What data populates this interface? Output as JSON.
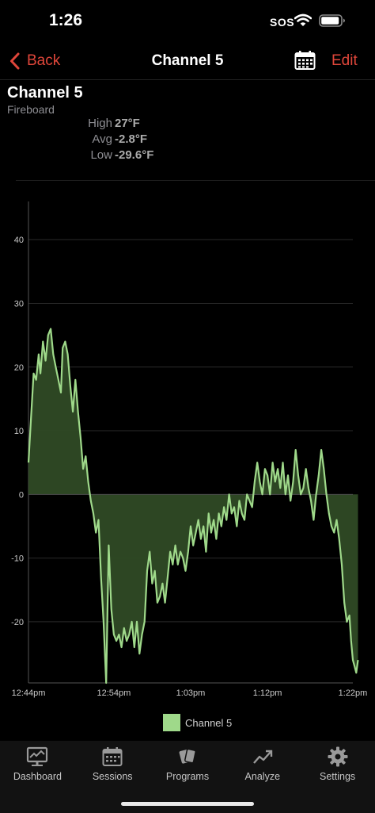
{
  "status_bar": {
    "time": "1:26",
    "carrier": "SOS"
  },
  "nav": {
    "back_label": "Back",
    "title": "Channel 5",
    "edit_label": "Edit"
  },
  "header": {
    "title": "Channel 5",
    "subtitle": "Fireboard",
    "stats": [
      {
        "label": "High",
        "value": "27°F"
      },
      {
        "label": "Avg",
        "value": "-2.8°F"
      },
      {
        "label": "Low",
        "value": "-29.6°F"
      }
    ]
  },
  "chart_data": {
    "type": "area",
    "title": "",
    "xlabel": "",
    "ylabel": "",
    "ylim": [
      -29.6,
      46
    ],
    "y_ticks": [
      40,
      30,
      20,
      10,
      0,
      -10,
      -20
    ],
    "x_tick_labels": [
      "12:44pm",
      "12:54pm",
      "1:03pm",
      "1:12pm",
      "1:22pm"
    ],
    "x_range_minutes": [
      0,
      38
    ],
    "x_tick_minutes": [
      0,
      10,
      19,
      28,
      38
    ],
    "grid": "horizontal",
    "baseline": 0,
    "series": [
      {
        "name": "Channel 5",
        "color": "#9fd98a",
        "points": [
          [
            0,
            5
          ],
          [
            0.3,
            12
          ],
          [
            0.6,
            19
          ],
          [
            0.9,
            18
          ],
          [
            1.2,
            22
          ],
          [
            1.4,
            19
          ],
          [
            1.7,
            24
          ],
          [
            2,
            21
          ],
          [
            2.3,
            25
          ],
          [
            2.6,
            26
          ],
          [
            2.9,
            22
          ],
          [
            3.2,
            20
          ],
          [
            3.5,
            18
          ],
          [
            3.8,
            16
          ],
          [
            4,
            23
          ],
          [
            4.3,
            24
          ],
          [
            4.6,
            22
          ],
          [
            4.9,
            17
          ],
          [
            5.2,
            13
          ],
          [
            5.5,
            18
          ],
          [
            5.8,
            13
          ],
          [
            6.1,
            9
          ],
          [
            6.4,
            4
          ],
          [
            6.7,
            6
          ],
          [
            7,
            2
          ],
          [
            7.3,
            -1
          ],
          [
            7.6,
            -3
          ],
          [
            7.9,
            -6
          ],
          [
            8.2,
            -4
          ],
          [
            8.5,
            -13
          ],
          [
            8.8,
            -20
          ],
          [
            9.1,
            -29.6
          ],
          [
            9.4,
            -8
          ],
          [
            9.7,
            -18
          ],
          [
            10,
            -22
          ],
          [
            10.3,
            -23
          ],
          [
            10.6,
            -22
          ],
          [
            10.9,
            -24
          ],
          [
            11.2,
            -21
          ],
          [
            11.5,
            -23
          ],
          [
            11.8,
            -22
          ],
          [
            12.1,
            -20
          ],
          [
            12.4,
            -24
          ],
          [
            12.7,
            -20
          ],
          [
            13,
            -25
          ],
          [
            13.3,
            -22
          ],
          [
            13.6,
            -20
          ],
          [
            13.9,
            -12
          ],
          [
            14.2,
            -9
          ],
          [
            14.5,
            -14
          ],
          [
            14.8,
            -12
          ],
          [
            15.1,
            -17
          ],
          [
            15.4,
            -16
          ],
          [
            15.7,
            -14
          ],
          [
            16,
            -17
          ],
          [
            16.3,
            -13
          ],
          [
            16.6,
            -9
          ],
          [
            16.9,
            -11
          ],
          [
            17.2,
            -8
          ],
          [
            17.5,
            -11
          ],
          [
            17.8,
            -9
          ],
          [
            18.1,
            -10
          ],
          [
            18.4,
            -12
          ],
          [
            18.7,
            -9
          ],
          [
            19,
            -5
          ],
          [
            19.3,
            -8
          ],
          [
            19.6,
            -6
          ],
          [
            19.9,
            -4
          ],
          [
            20.2,
            -7
          ],
          [
            20.5,
            -5
          ],
          [
            20.8,
            -9
          ],
          [
            21.1,
            -3
          ],
          [
            21.4,
            -6
          ],
          [
            21.7,
            -4
          ],
          [
            22,
            -7
          ],
          [
            22.3,
            -3
          ],
          [
            22.6,
            -5
          ],
          [
            22.9,
            -2
          ],
          [
            23.2,
            -4
          ],
          [
            23.5,
            0
          ],
          [
            23.8,
            -3
          ],
          [
            24.1,
            -2
          ],
          [
            24.4,
            -5
          ],
          [
            24.7,
            -1
          ],
          [
            25,
            -3
          ],
          [
            25.3,
            -4
          ],
          [
            25.6,
            0
          ],
          [
            25.9,
            -1
          ],
          [
            26.2,
            -2
          ],
          [
            26.5,
            2
          ],
          [
            26.8,
            5
          ],
          [
            27.1,
            2
          ],
          [
            27.4,
            0
          ],
          [
            27.7,
            4
          ],
          [
            28,
            3
          ],
          [
            28.3,
            0
          ],
          [
            28.6,
            5
          ],
          [
            28.9,
            2
          ],
          [
            29.2,
            4
          ],
          [
            29.5,
            1
          ],
          [
            29.8,
            5
          ],
          [
            30.1,
            0
          ],
          [
            30.4,
            3
          ],
          [
            30.7,
            -1
          ],
          [
            31,
            2
          ],
          [
            31.3,
            7
          ],
          [
            31.6,
            3
          ],
          [
            31.9,
            0
          ],
          [
            32.2,
            1
          ],
          [
            32.5,
            4
          ],
          [
            32.8,
            1
          ],
          [
            33.1,
            -1
          ],
          [
            33.4,
            -4
          ],
          [
            33.7,
            0
          ],
          [
            34,
            3
          ],
          [
            34.3,
            7
          ],
          [
            34.6,
            4
          ],
          [
            34.9,
            0
          ],
          [
            35.2,
            -3
          ],
          [
            35.5,
            -5
          ],
          [
            35.8,
            -6
          ],
          [
            36.1,
            -4
          ],
          [
            36.4,
            -7
          ],
          [
            36.7,
            -11
          ],
          [
            37,
            -17
          ],
          [
            37.3,
            -20
          ],
          [
            37.6,
            -19
          ],
          [
            37.8,
            -23
          ],
          [
            38,
            -26
          ],
          [
            38.2,
            -27
          ],
          [
            38.4,
            -28
          ],
          [
            38.6,
            -26
          ]
        ]
      }
    ],
    "legend": {
      "position": "bottom-center",
      "label": "Channel 5"
    }
  },
  "tabbar": {
    "items": [
      {
        "label": "Dashboard",
        "icon": "dashboard-icon"
      },
      {
        "label": "Sessions",
        "icon": "calendar-icon"
      },
      {
        "label": "Programs",
        "icon": "programs-icon"
      },
      {
        "label": "Analyze",
        "icon": "analyze-icon"
      },
      {
        "label": "Settings",
        "icon": "gear-icon"
      }
    ]
  },
  "colors": {
    "accent": "#e0463a",
    "series": "#9fd98a",
    "fill": "#2f4a25",
    "background": "#000000"
  }
}
